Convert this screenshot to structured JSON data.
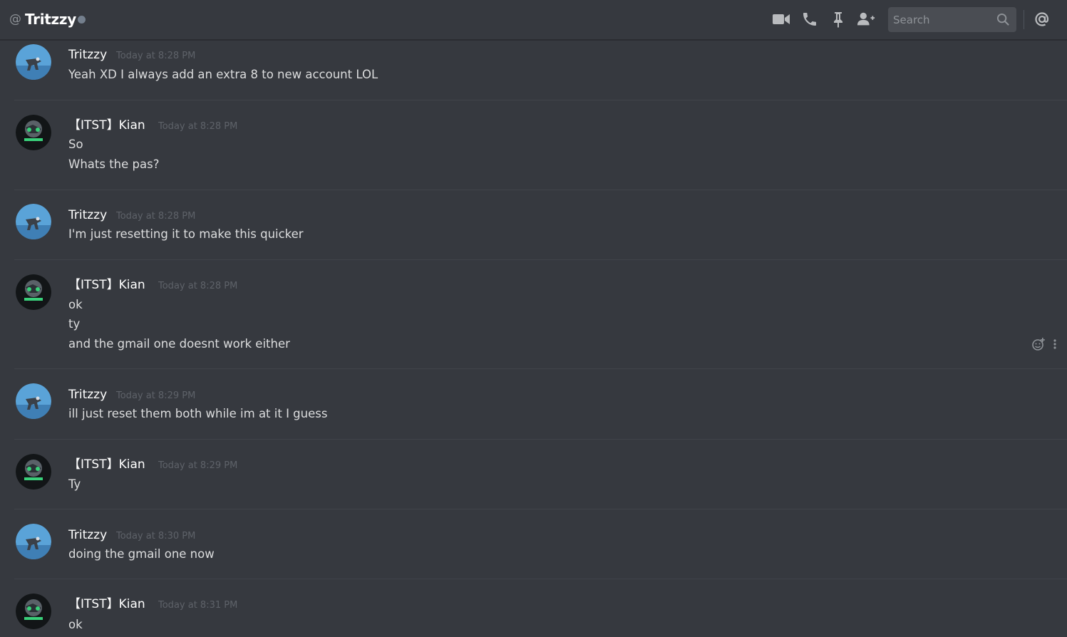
{
  "header": {
    "at_symbol": "@",
    "channel_name": "Tritzzy",
    "search_placeholder": "Search",
    "icons": [
      "video-call-icon",
      "voice-call-icon",
      "pin-icon",
      "add-friend-icon",
      "search-icon",
      "mention-icon"
    ]
  },
  "messages": [
    {
      "author": "Tritzzy",
      "timestamp": "Today at 8:28 PM",
      "lines": [
        "Yeah XD I always add an extra 8 to new account LOL"
      ]
    },
    {
      "author": "【ITST】Kian",
      "timestamp": "Today at 8:28 PM",
      "lines": [
        "So",
        "Whats the pas?"
      ]
    },
    {
      "author": "Tritzzy",
      "timestamp": "Today at 8:28 PM",
      "lines": [
        "I'm just resetting it to make this quicker"
      ]
    },
    {
      "author": "【ITST】Kian",
      "timestamp": "Today at 8:28 PM",
      "lines": [
        "ok",
        "ty",
        "and the gmail one doesnt work either"
      ]
    },
    {
      "author": "Tritzzy",
      "timestamp": "Today at 8:29 PM",
      "lines": [
        "ill just reset them both while im at it I guess"
      ]
    },
    {
      "author": "【ITST】Kian",
      "timestamp": "Today at 8:29 PM",
      "lines": [
        "Ty"
      ]
    },
    {
      "author": "Tritzzy",
      "timestamp": "Today at 8:30 PM",
      "lines": [
        "doing the gmail one now"
      ]
    },
    {
      "author": "【ITST】Kian",
      "timestamp": "Today at 8:31 PM",
      "lines": [
        "ok"
      ]
    }
  ],
  "colors": {
    "background": "#36393f",
    "username": "#ffffff",
    "message_text": "#dcddde",
    "timestamp": "#5e6269",
    "icon": "#b9bbbe"
  }
}
